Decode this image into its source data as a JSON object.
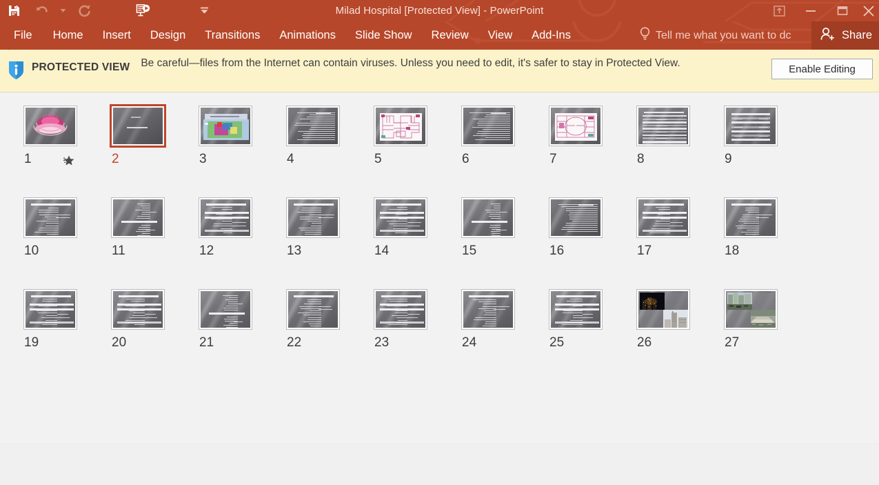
{
  "window": {
    "title": "Milad Hospital [Protected View] - PowerPoint",
    "accent_color": "#b7472a",
    "share_bg_color": "#a03d23"
  },
  "quick_access": {
    "items": [
      {
        "name": "save-icon",
        "label": "Save",
        "enabled": true
      },
      {
        "name": "undo-icon",
        "label": "Undo",
        "enabled": false
      },
      {
        "name": "undo-dropdown-icon",
        "label": "Undo options",
        "enabled": false
      },
      {
        "name": "redo-icon",
        "label": "Redo",
        "enabled": false
      },
      {
        "name": "start-slideshow-icon",
        "label": "Start From Beginning",
        "enabled": true
      },
      {
        "name": "customize-qat-icon",
        "label": "Customize Quick Access Toolbar",
        "enabled": true
      }
    ]
  },
  "window_controls": [
    {
      "name": "ribbon-display-options-icon",
      "label": "Ribbon Display Options"
    },
    {
      "name": "minimize-icon",
      "label": "Minimize"
    },
    {
      "name": "restore-icon",
      "label": "Restore Down"
    },
    {
      "name": "close-icon",
      "label": "Close"
    }
  ],
  "ribbon": {
    "tabs": [
      {
        "label": "File",
        "active": false
      },
      {
        "label": "Home",
        "active": false
      },
      {
        "label": "Insert",
        "active": false
      },
      {
        "label": "Design",
        "active": false
      },
      {
        "label": "Transitions",
        "active": false
      },
      {
        "label": "Animations",
        "active": false
      },
      {
        "label": "Slide Show",
        "active": false
      },
      {
        "label": "Review",
        "active": false
      },
      {
        "label": "View",
        "active": false
      },
      {
        "label": "Add-Ins",
        "active": false
      }
    ],
    "tell_me": {
      "icon": "lightbulb-icon",
      "placeholder": "Tell me what you want to dc"
    },
    "share": {
      "icon": "share-person-icon",
      "label": "Share"
    }
  },
  "protected_view": {
    "icon": "info-shield-icon",
    "label": "PROTECTED VIEW",
    "message": "Be careful—files from the Internet can contain viruses. Unless you need to edit, it's safer to stay in Protected View.",
    "button_label": "Enable Editing",
    "bg_color": "#fcf3ca"
  },
  "slide_sorter": {
    "selected_slide": 2,
    "columns": 9,
    "slides": [
      {
        "number": "1",
        "kind": "floral",
        "has_transition": true
      },
      {
        "number": "2",
        "kind": "title",
        "has_transition": false
      },
      {
        "number": "3",
        "kind": "map",
        "has_transition": false
      },
      {
        "number": "4",
        "kind": "text",
        "has_transition": false
      },
      {
        "number": "5",
        "kind": "plan-a",
        "has_transition": false
      },
      {
        "number": "6",
        "kind": "text",
        "has_transition": false
      },
      {
        "number": "7",
        "kind": "plan-b",
        "has_transition": false
      },
      {
        "number": "8",
        "kind": "table",
        "has_transition": false
      },
      {
        "number": "9",
        "kind": "table2",
        "has_transition": false
      },
      {
        "number": "10",
        "kind": "list",
        "has_transition": false
      },
      {
        "number": "11",
        "kind": "list2",
        "has_transition": false
      },
      {
        "number": "12",
        "kind": "list3",
        "has_transition": false
      },
      {
        "number": "13",
        "kind": "list",
        "has_transition": false
      },
      {
        "number": "14",
        "kind": "list3",
        "has_transition": false
      },
      {
        "number": "15",
        "kind": "list2",
        "has_transition": false
      },
      {
        "number": "16",
        "kind": "text",
        "has_transition": false
      },
      {
        "number": "17",
        "kind": "list3",
        "has_transition": false
      },
      {
        "number": "18",
        "kind": "list",
        "has_transition": false
      },
      {
        "number": "19",
        "kind": "list3",
        "has_transition": false
      },
      {
        "number": "20",
        "kind": "list3",
        "has_transition": false
      },
      {
        "number": "21",
        "kind": "list2",
        "has_transition": false
      },
      {
        "number": "22",
        "kind": "list",
        "has_transition": false
      },
      {
        "number": "23",
        "kind": "list3",
        "has_transition": false
      },
      {
        "number": "24",
        "kind": "list",
        "has_transition": false
      },
      {
        "number": "25",
        "kind": "list3",
        "has_transition": false
      },
      {
        "number": "26",
        "kind": "photos-night",
        "has_transition": false
      },
      {
        "number": "27",
        "kind": "photos-city",
        "has_transition": false
      }
    ]
  }
}
